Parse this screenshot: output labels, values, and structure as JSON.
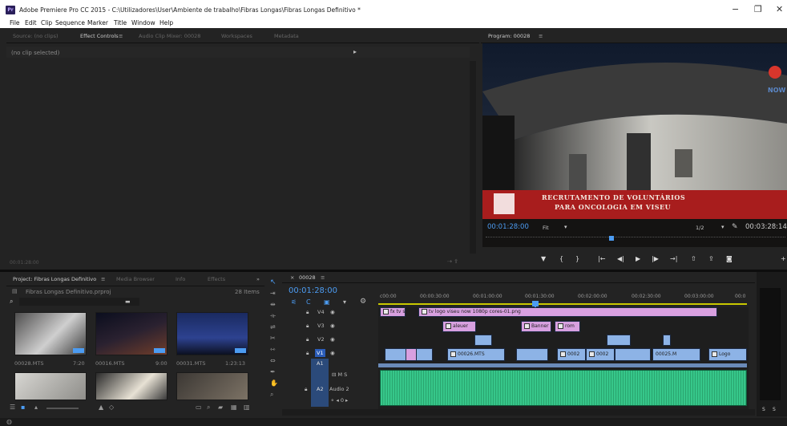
{
  "window": {
    "title": "Adobe Premiere Pro CC 2015 - C:\\Utilizadores\\User\\Ambiente de trabalho\\Fibras Longas\\Fibras Longas Definitivo *",
    "min": "−",
    "max": "❐",
    "close": "✕"
  },
  "menu": [
    "File",
    "Edit",
    "Clip",
    "Sequence",
    "Marker",
    "Title",
    "Window",
    "Help"
  ],
  "source_panel": {
    "tabs": [
      "Source: (no clips)",
      "Effect Controls",
      "Audio Clip Mixer: 00028",
      "Workspaces",
      "Metadata"
    ],
    "no_clip": "(no clip selected)",
    "timecode": "00:01:28:00"
  },
  "program": {
    "tab": "Program: 00028",
    "lower_third_line1": "RECRUTAMENTO DE VOLUNTÁRIOS",
    "lower_third_line2": "PARA ONCOLOGIA EM VISEU",
    "logo_text": "NOW",
    "timecode": "00:01:28:00",
    "fit": "Fit",
    "resolution": "1/2",
    "duration": "00:03:28:14"
  },
  "project": {
    "tabs": [
      "Project: Fibras Longas Definitivo",
      "Media Browser",
      "Info",
      "Effects"
    ],
    "file": "Fibras Longas Definitivo.prproj",
    "items_count": "28 Items",
    "clips": [
      {
        "name": "00028.MTS",
        "duration": "7:20"
      },
      {
        "name": "00016.MTS",
        "duration": "9:00"
      },
      {
        "name": "00031.MTS",
        "duration": "1:23:13"
      }
    ]
  },
  "timeline": {
    "tab": "00028",
    "timecode": "00:01:28:00",
    "ruler": [
      "c00:00",
      "00:00:30:00",
      "00:01:00:00",
      "00:01:30:00",
      "00:02:00:00",
      "00:02:30:00",
      "00:03:00:00",
      "00:0"
    ],
    "tracks": [
      "V4",
      "V3",
      "V2",
      "V1",
      "A1",
      "A2"
    ],
    "a2_name": "Audio 2",
    "a1_label": "A1",
    "clips": {
      "v4_a": "fx tv s",
      "v4_b": "tv logo viseu now 1080p cores-01.png",
      "v3_a": "aleuer",
      "v3_b": "Banner",
      "v3_c": "rom",
      "v1_a": "00026.MTS",
      "v1_b": "0002",
      "v1_c": "0002",
      "v1_d": "00025.M",
      "v1_e": "Logo"
    }
  },
  "meters": {
    "left": "S",
    "right": "S"
  }
}
